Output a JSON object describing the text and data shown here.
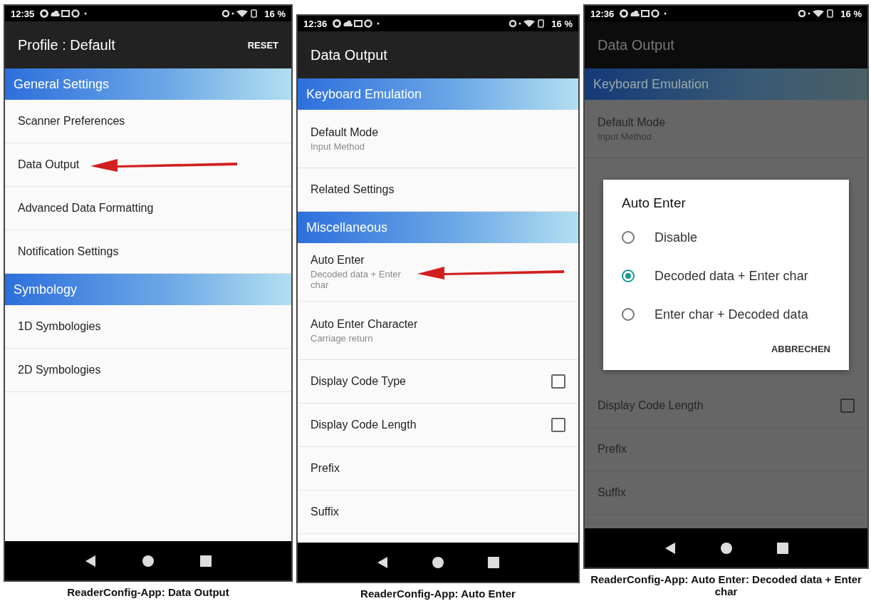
{
  "phones": [
    {
      "status": {
        "time": "12:35",
        "battery": "16 %"
      },
      "appbar": {
        "title": "Profile : Default",
        "action": "RESET"
      },
      "list": [
        {
          "kind": "header",
          "label": "General Settings"
        },
        {
          "kind": "item",
          "label": "Scanner Preferences",
          "pointed": false
        },
        {
          "kind": "item",
          "label": "Data Output",
          "pointed": true
        },
        {
          "kind": "item",
          "label": "Advanced Data Formatting",
          "pointed": false
        },
        {
          "kind": "item",
          "label": "Notification Settings",
          "pointed": false
        },
        {
          "kind": "header",
          "label": "Symbology"
        },
        {
          "kind": "item",
          "label": "1D Symbologies",
          "pointed": false
        },
        {
          "kind": "item",
          "label": "2D Symbologies",
          "pointed": false
        }
      ],
      "caption": "ReaderConfig-App: Data Output"
    },
    {
      "status": {
        "time": "12:36",
        "battery": "16 %"
      },
      "appbar": {
        "title": "Data Output"
      },
      "list": [
        {
          "kind": "header",
          "label": "Keyboard Emulation"
        },
        {
          "kind": "item",
          "label": "Default Mode",
          "summary": "Input Method",
          "pointed": false
        },
        {
          "kind": "item",
          "label": "Related Settings",
          "pointed": false
        },
        {
          "kind": "header",
          "label": "Miscellaneous"
        },
        {
          "kind": "item",
          "label": "Auto Enter",
          "summary": "Decoded data + Enter char",
          "pointed": true
        },
        {
          "kind": "item",
          "label": "Auto Enter Character",
          "summary": "Carriage return",
          "pointed": false
        },
        {
          "kind": "checkbox",
          "label": "Display Code Type",
          "checked": false
        },
        {
          "kind": "checkbox",
          "label": "Display Code Length",
          "checked": false
        },
        {
          "kind": "item",
          "label": "Prefix",
          "pointed": false
        },
        {
          "kind": "item",
          "label": "Suffix",
          "pointed": false
        }
      ],
      "caption": "ReaderConfig-App: Auto Enter"
    },
    {
      "status": {
        "time": "12:36",
        "battery": "16 %"
      },
      "appbar": {
        "title": "Data Output"
      },
      "list": [
        {
          "kind": "header",
          "label": "Keyboard Emulation"
        },
        {
          "kind": "item",
          "label": "Default Mode",
          "summary": "Input Method",
          "pointed": false
        },
        {
          "kind": "dialog",
          "title": "Auto Enter",
          "options": [
            {
              "label": "Disable",
              "selected": false
            },
            {
              "label": "Decoded data + Enter char",
              "selected": true
            },
            {
              "label": "Enter char + Decoded data",
              "selected": false
            }
          ],
          "button": "ABBRECHEN"
        },
        {
          "kind": "checkbox",
          "label": "Display Code Length",
          "checked": false
        },
        {
          "kind": "item",
          "label": "Prefix",
          "pointed": false
        },
        {
          "kind": "item",
          "label": "Suffix",
          "pointed": false
        }
      ],
      "caption": "ReaderConfig-App: Auto Enter: Decoded data + Enter char"
    }
  ]
}
